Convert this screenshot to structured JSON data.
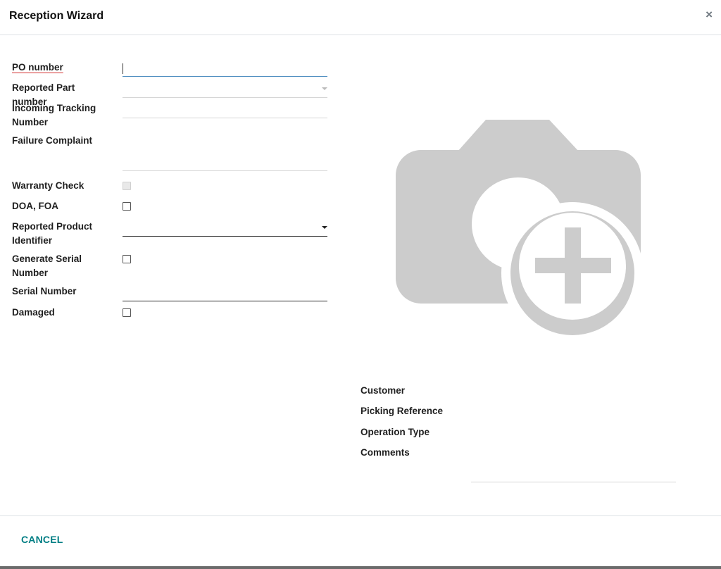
{
  "dialog": {
    "title": "Reception Wizard",
    "close_symbol": "×"
  },
  "form": {
    "po_number": {
      "label": "PO number",
      "value": ""
    },
    "reported_part_number": {
      "label": "Reported Part number",
      "value": ""
    },
    "incoming_tracking_number": {
      "label": "Incoming Tracking Number",
      "value": ""
    },
    "failure_complaint": {
      "label": "Failure Complaint",
      "value": ""
    },
    "warranty_check": {
      "label": "Warranty Check",
      "checked": false,
      "disabled": true
    },
    "doa_foa": {
      "label": "DOA, FOA",
      "checked": false
    },
    "reported_product_identifier": {
      "label": "Reported Product Identifier",
      "value": ""
    },
    "generate_serial_number": {
      "label": "Generate Serial Number",
      "checked": false
    },
    "serial_number": {
      "label": "Serial Number",
      "value": ""
    },
    "damaged": {
      "label": "Damaged",
      "checked": false
    }
  },
  "image_placeholder": {
    "icon": "camera-plus-icon",
    "color": "#cccccc"
  },
  "right_fields": {
    "customer": {
      "label": "Customer",
      "value": ""
    },
    "picking_reference": {
      "label": "Picking Reference",
      "value": ""
    },
    "operation_type": {
      "label": "Operation Type",
      "value": ""
    },
    "comments": {
      "label": "Comments",
      "value": ""
    }
  },
  "footer": {
    "cancel_label": "CANCEL"
  },
  "colors": {
    "accent": "#017e84",
    "required_underline": "#d32f2f"
  }
}
